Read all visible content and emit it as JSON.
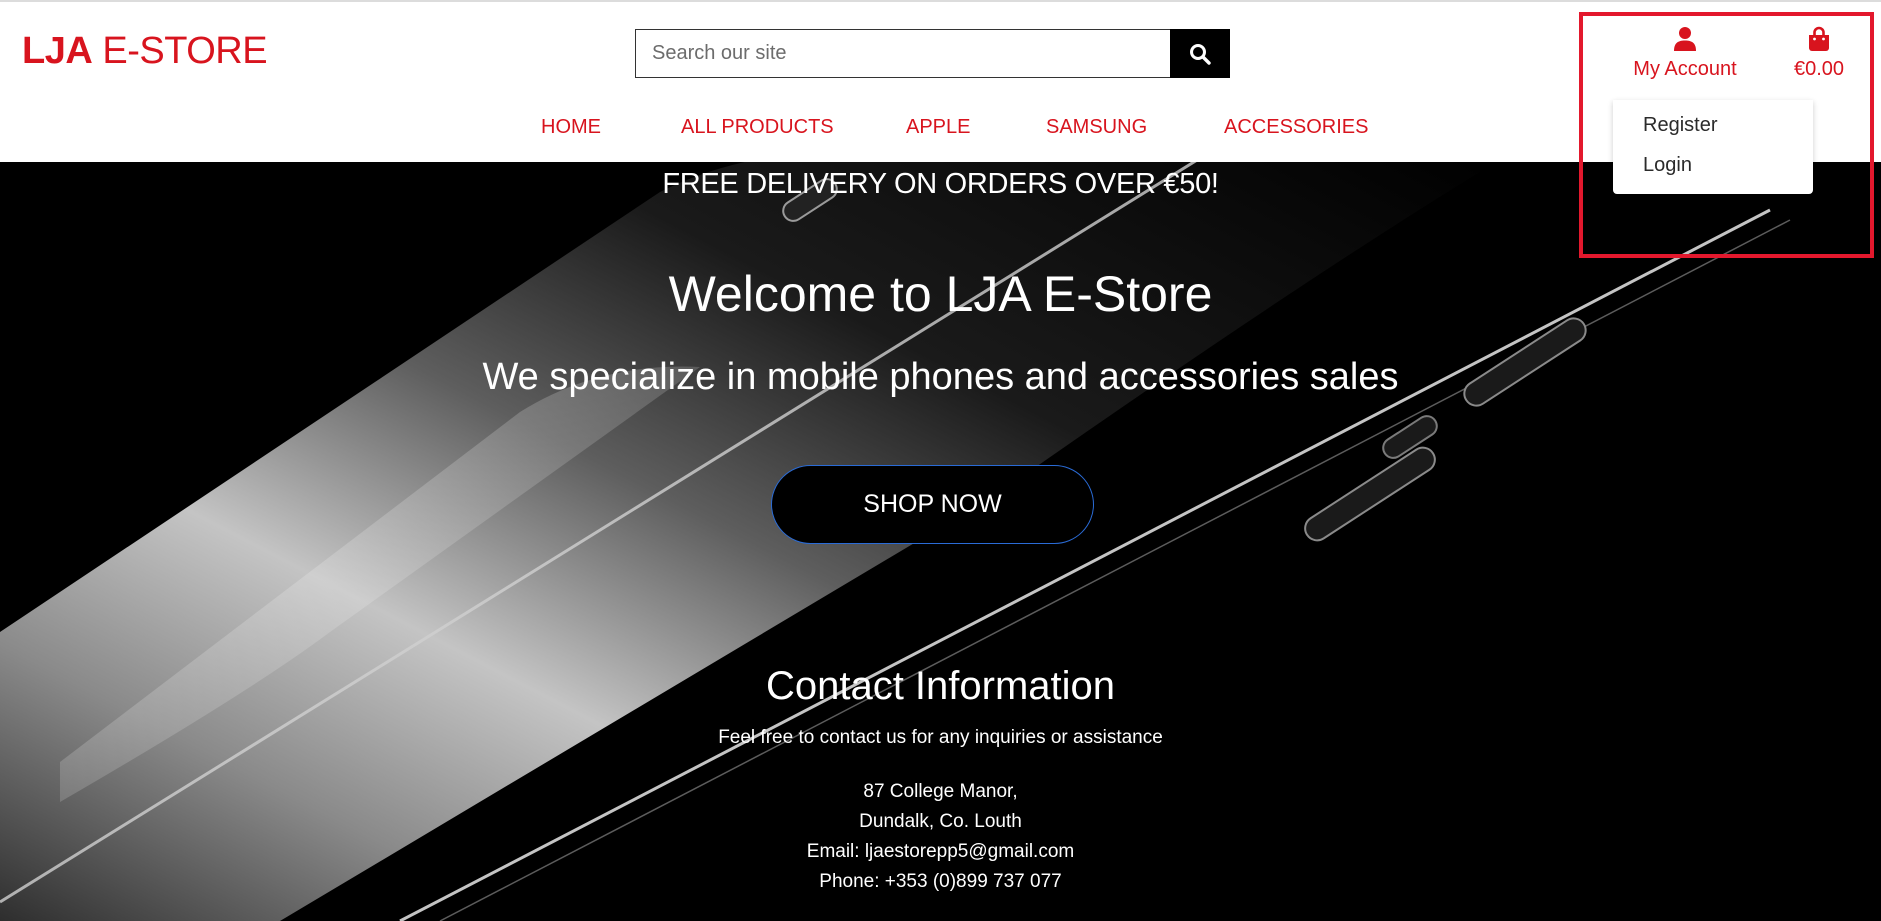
{
  "header": {
    "logo_strong": "LJA",
    "logo_light": " E-STORE",
    "search": {
      "placeholder": "Search our site"
    },
    "nav": [
      "HOME",
      "ALL PRODUCTS",
      "APPLE",
      "SAMSUNG",
      "ACCESSORIES"
    ],
    "account": {
      "label": "My Account",
      "icon": "user-icon"
    },
    "cart": {
      "total": "€0.00",
      "icon": "shopping-bag-icon"
    }
  },
  "account_menu": {
    "items": [
      "Register",
      "Login"
    ]
  },
  "hero": {
    "banner": "FREE DELIVERY ON ORDERS OVER €50!",
    "title": "Welcome to LJA E-Store",
    "subtitle": "We specialize in mobile phones and accessories sales",
    "cta": "SHOP NOW"
  },
  "contact": {
    "heading": "Contact Information",
    "intro": "Feel free to contact us for any inquiries or assistance",
    "address_line1": "87 College Manor,",
    "address_line2": "Dundalk, Co. Louth",
    "email": "Email: ljaestorepp5@gmail.com",
    "phone": "Phone: +353 (0)899 737 077"
  },
  "colors": {
    "brand_red": "#d8141e",
    "highlight_red": "#e3182d",
    "button_border_blue": "#2a6bd6",
    "hero_background": "#000000"
  }
}
